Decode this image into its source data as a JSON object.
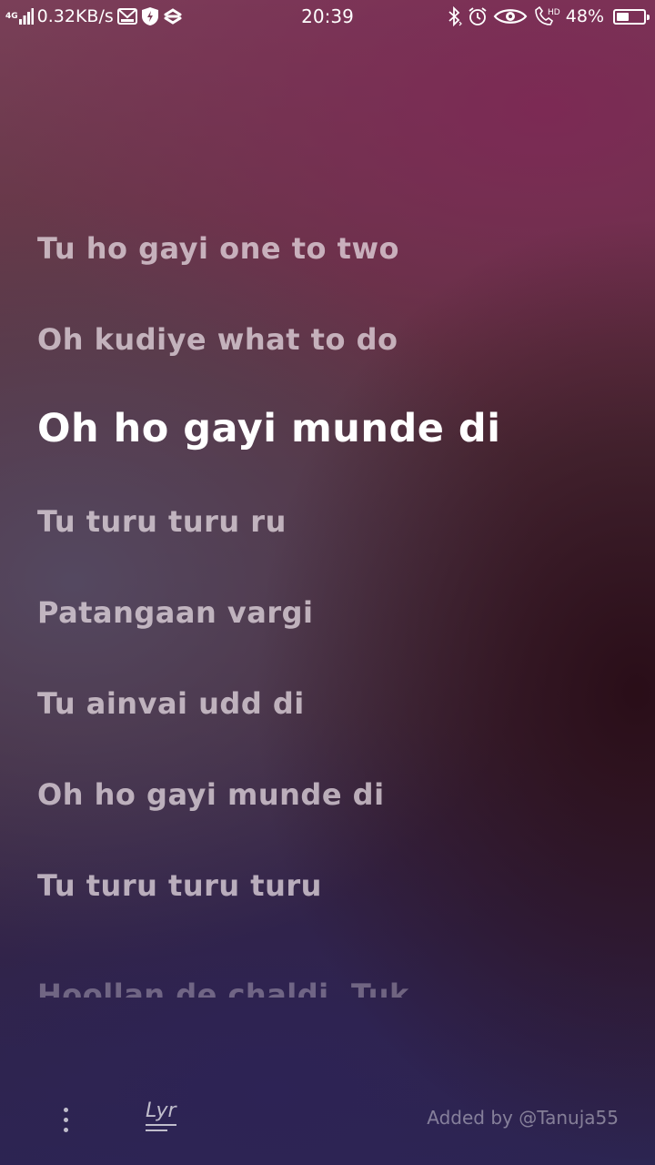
{
  "status_bar": {
    "network_type": "4G",
    "data_speed": "0.32KB/s",
    "time": "20:39",
    "battery_percent": "48%",
    "battery_level": 0.48,
    "left_icons": [
      "signal-icon",
      "gmail-icon",
      "shield-icon",
      "sync-icon"
    ],
    "right_icons": [
      "bluetooth-icon",
      "alarm-icon",
      "eye-icon",
      "hd-call-icon",
      "battery-icon"
    ],
    "hd_label": "HD"
  },
  "lyrics": {
    "lines": [
      {
        "text": "Tu ho gayi one to two",
        "state": "past"
      },
      {
        "text": "Oh kudiye what to do",
        "state": "past"
      },
      {
        "text": "Oh ho gayi munde di",
        "state": "current"
      },
      {
        "text": "Tu turu turu ru",
        "state": "upcoming"
      },
      {
        "text": "Patangaan vargi",
        "state": "upcoming"
      },
      {
        "text": "Tu ainvai udd di",
        "state": "upcoming"
      },
      {
        "text": "Oh ho gayi munde di",
        "state": "upcoming"
      },
      {
        "text": "Tu turu turu turu",
        "state": "upcoming"
      },
      {
        "text": "Hoollan de chaldi, Tuk",
        "state": "fading"
      }
    ]
  },
  "bottom_bar": {
    "menu_icon": "more-vertical-icon",
    "logo_text": "Lyr",
    "added_by": "Added by @Tanuja55"
  }
}
